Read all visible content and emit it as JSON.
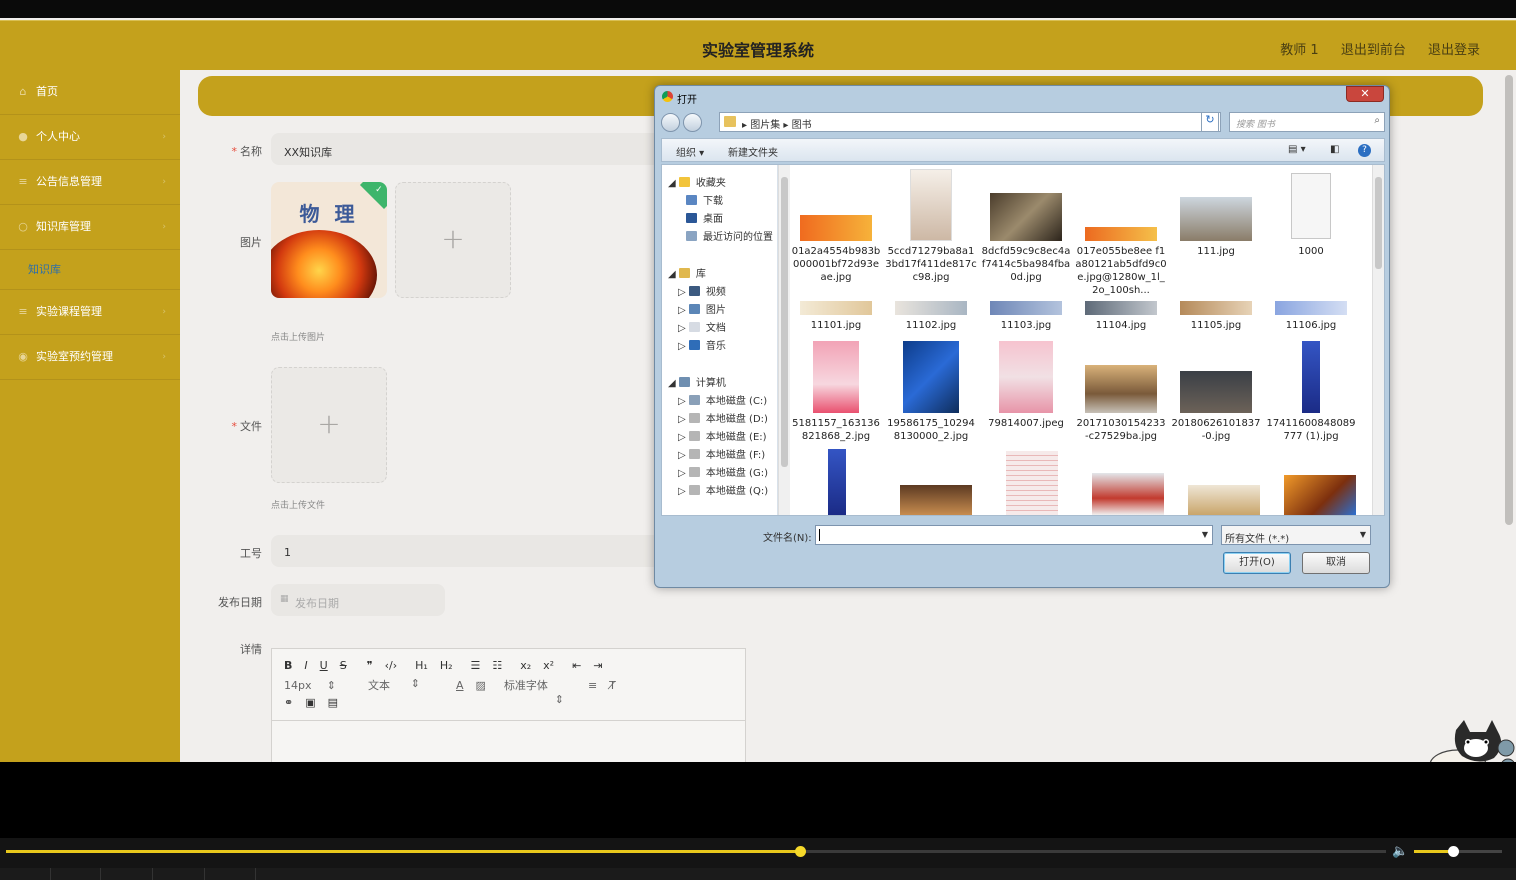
{
  "app": {
    "title": "实验室管理系统",
    "header_links": [
      "教师 1",
      "退出到前台",
      "退出登录"
    ]
  },
  "sidebar": {
    "items": [
      {
        "label": "首页",
        "icon": "home-icon"
      },
      {
        "label": "个人中心",
        "icon": "user-icon"
      },
      {
        "label": "公告信息管理",
        "icon": "list-icon"
      },
      {
        "label": "知识库管理",
        "icon": "book-icon"
      },
      {
        "label": "实验课程管理",
        "icon": "list-icon"
      },
      {
        "label": "实验室预约管理",
        "icon": "pin-icon"
      }
    ],
    "sub_item": "知识库"
  },
  "form": {
    "name_label": "名称",
    "name_value": "XX知识库",
    "image_label": "图片",
    "image_book_title": "物 理",
    "image_hint": "点击上传图片",
    "file_label": "文件",
    "file_hint": "点击上传文件",
    "job_label": "工号",
    "job_value": "1",
    "date_label": "发布日期",
    "date_placeholder": "发布日期",
    "detail_label": "详情",
    "editor": {
      "font_size": "14px",
      "block": "文本",
      "font": "标准字体"
    }
  },
  "dialog": {
    "title": "打开",
    "close": "✕",
    "path": [
      "图片集",
      "图书"
    ],
    "search_placeholder": "搜索 图书",
    "toolbar": {
      "organize": "组织 ▾",
      "new_folder": "新建文件夹"
    },
    "tree": {
      "favorites": "收藏夹",
      "fav_items": [
        "下载",
        "桌面",
        "最近访问的位置"
      ],
      "library": "库",
      "lib_items": [
        "视频",
        "图片",
        "文档",
        "音乐"
      ],
      "computer": "计算机",
      "drives": [
        "本地磁盘 (C:)",
        "本地磁盘 (D:)",
        "本地磁盘 (E:)",
        "本地磁盘 (F:)",
        "本地磁盘 (G:)",
        "本地磁盘 (Q:)"
      ]
    },
    "files": [
      "01a2a4554b983b000001bf72d93eae.jpg",
      "5ccd71279ba8a13bd17f411de817cc98.jpg",
      "8dcfd59c9c8ec4af7414c5ba984fba0d.jpg",
      "017e055be8ee f1a80121ab5dfd9c0e.jpg@1280w_1l_2o_100sh...",
      "111.jpg",
      "1000",
      "11101.jpg",
      "11102.jpg",
      "11103.jpg",
      "11104.jpg",
      "11105.jpg",
      "11106.jpg",
      "5181157_163136821868_2.jpg",
      "19586175_102948130000_2.jpg",
      "79814007.jpeg",
      "20171030154233-c27529ba.jpg",
      "20180626101837-0.jpg",
      "17411600848089777 (1).jpg"
    ],
    "filename_label": "文件名(N):",
    "filetype": "所有文件 (*.*)",
    "open_button": "打开(O)",
    "cancel_button": "取消"
  },
  "colors": {
    "accent": "#c4a11c",
    "progress": "#e8c81c"
  },
  "player": {
    "progress": 0.575,
    "volume": 0.44
  }
}
